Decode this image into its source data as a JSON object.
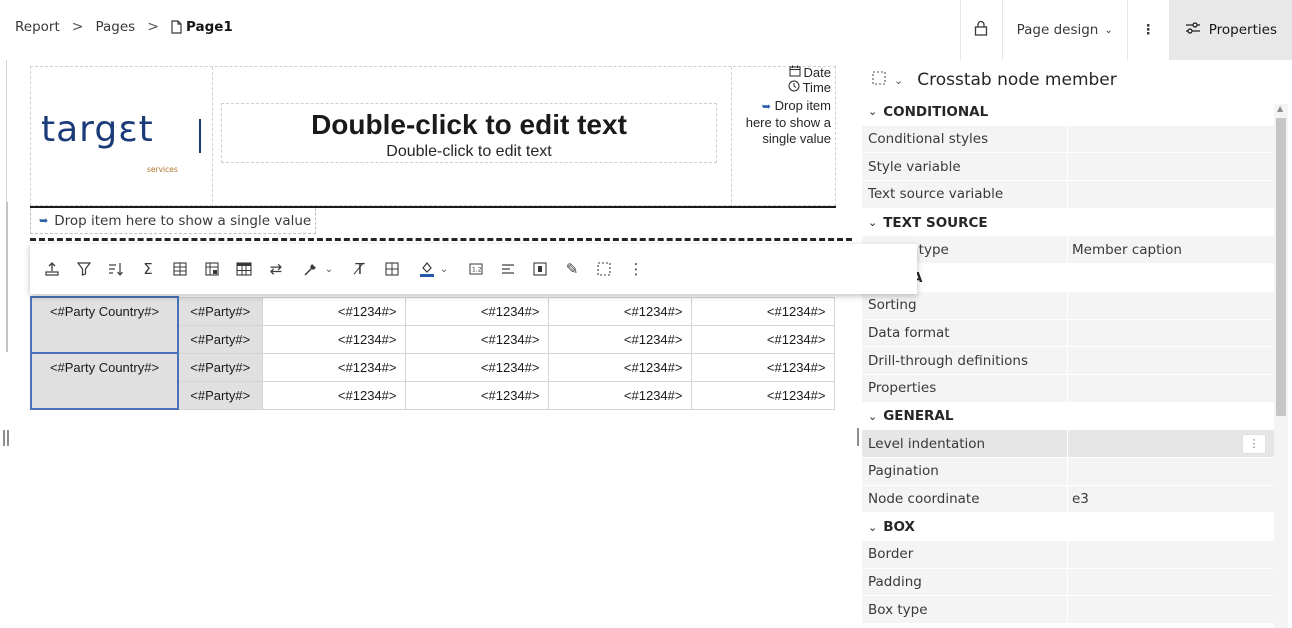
{
  "breadcrumb": {
    "items": [
      "Report",
      "Pages"
    ],
    "separator": ">",
    "current": "Page1"
  },
  "topbar": {
    "page_design_label": "Page design",
    "properties_label": "Properties"
  },
  "header": {
    "logo_text": "targεt",
    "logo_sub": "services",
    "title": "Double-click to edit text",
    "subtitle": "Double-click to edit text",
    "date_label": "Date",
    "time_label": "Time",
    "drop_single_value": "Drop item here to show a single value"
  },
  "drop_bar_label": "Drop item here to show a single value",
  "toolbar": {
    "icons": [
      "insert-icon",
      "filter-icon",
      "sort-icon",
      "summarize-icon",
      "insert-table-icon",
      "crosstab-icon",
      "table-icon",
      "swap-icon",
      "color-picker-icon",
      "text-style-icon",
      "border-icon",
      "fill-icon",
      "format-icon",
      "align-icon",
      "list-icon",
      "clear-icon",
      "select-ancestor-icon",
      "more-icon"
    ]
  },
  "crosstab": {
    "rows": [
      {
        "country": "<#Party Country#>",
        "party": "<#Party#>",
        "values": [
          "<#1234#>",
          "<#1234#>",
          "<#1234#>",
          "<#1234#>"
        ]
      },
      {
        "country": "",
        "party": "<#Party#>",
        "values": [
          "<#1234#>",
          "<#1234#>",
          "<#1234#>",
          "<#1234#>"
        ]
      },
      {
        "country": "<#Party Country#>",
        "party": "<#Party#>",
        "values": [
          "<#1234#>",
          "<#1234#>",
          "<#1234#>",
          "<#1234#>"
        ]
      },
      {
        "country": "",
        "party": "<#Party#>",
        "values": [
          "<#1234#>",
          "<#1234#>",
          "<#1234#>",
          "<#1234#>"
        ]
      }
    ]
  },
  "panel": {
    "title": "Crosstab node member",
    "sections": [
      {
        "title": "CONDITIONAL",
        "rows": [
          {
            "key": "Conditional styles",
            "value": ""
          },
          {
            "key": "Style variable",
            "value": ""
          },
          {
            "key": "Text source variable",
            "value": ""
          }
        ]
      },
      {
        "title": "TEXT SOURCE",
        "rows": [
          {
            "key": "Source type",
            "value": "Member caption"
          }
        ]
      },
      {
        "title": "DATA",
        "rows": [
          {
            "key": "Sorting",
            "value": ""
          },
          {
            "key": "Data format",
            "value": ""
          },
          {
            "key": "Drill-through definitions",
            "value": ""
          },
          {
            "key": "Properties",
            "value": ""
          }
        ]
      },
      {
        "title": "GENERAL",
        "rows": [
          {
            "key": "Level indentation",
            "value": ""
          },
          {
            "key": "Pagination",
            "value": ""
          },
          {
            "key": "Node coordinate",
            "value": "e3"
          }
        ]
      },
      {
        "title": "BOX",
        "rows": [
          {
            "key": "Border",
            "value": ""
          },
          {
            "key": "Padding",
            "value": ""
          },
          {
            "key": "Box type",
            "value": ""
          }
        ]
      }
    ]
  },
  "colors": {
    "accent": "#2458a8",
    "logo": "#1b3a78",
    "selection": "#4a72b8",
    "panel_row": "#f4f4f4"
  }
}
